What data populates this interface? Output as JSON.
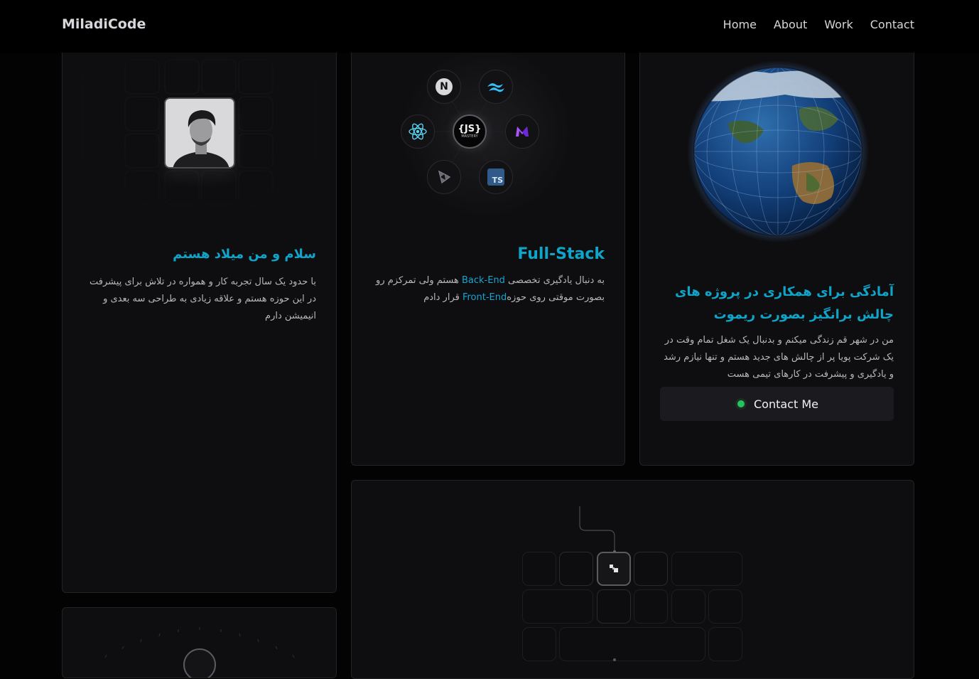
{
  "nav": {
    "logo": "MiladiCode",
    "links": [
      "Home",
      "About",
      "Work",
      "Contact"
    ]
  },
  "about_card": {
    "title": "سلام و من میلاد هستم",
    "body": "با حدود یک سال تجربه کار و همواره در تلاش برای پیشرفت در این حوزه هستم و علاقه زیادی به طراحی سه بعدی و انیمیشن دارم"
  },
  "stack_card": {
    "title": "Full-Stack",
    "body_1": "به دنبال یادگیری تخصصی ",
    "backend": "Back-End",
    "body_2": " هستم ولی تمرکزم رو بصورت موقتی روی حوزه",
    "frontend": "Front-End",
    "body_3": " قرار دادم",
    "icons": [
      "nextjs-icon",
      "tailwind-icon",
      "react-icon",
      "jsmastery-icon",
      "framer-icon",
      "threejs-icon",
      "typescript-icon"
    ],
    "center_logo": "{JS}",
    "center_sub": "MASTERY",
    "next_letter": "N",
    "ts_label": "TS"
  },
  "remote_card": {
    "title": "آمادگی برای همکاری در پروژه های چالش برانگیز بصورت ریموت",
    "body": "من در شهر قم زندگی میکنم و بدنبال یک شغل تمام وقت در یک شرکت پویا پر از چالش های جدید هستم و تنها نیازم رشد و یادگیری و پیشرفت در کارهای تیمی هست",
    "button_label": "Contact Me"
  },
  "colors": {
    "accent_cyan": "#0fa4c8",
    "status_green": "#22c55e",
    "card_bg": "#0e0e10"
  }
}
